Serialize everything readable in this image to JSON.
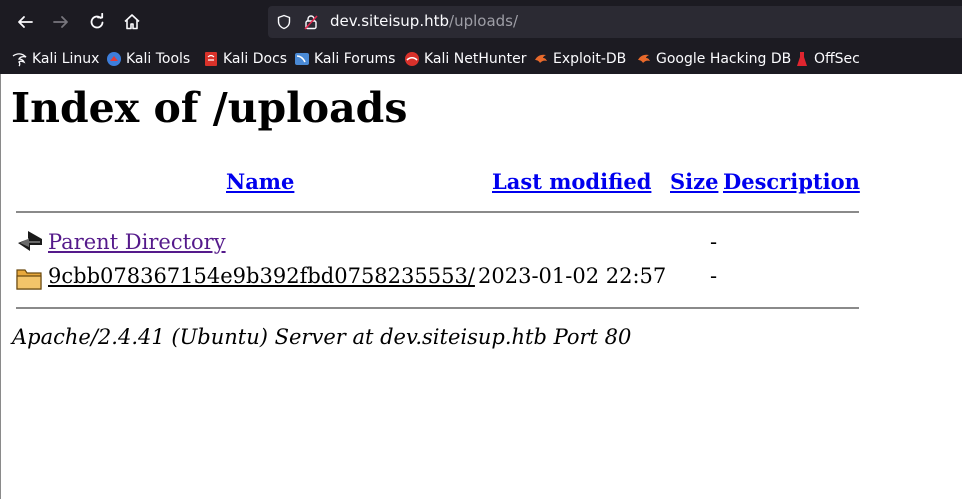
{
  "browser": {
    "url_host": "dev.siteisup.htb",
    "url_path": "/uploads/",
    "bookmarks": [
      {
        "label": "Kali Linux",
        "icon": "kali-dragon-icon"
      },
      {
        "label": "Kali Tools",
        "icon": "kali-tools-icon"
      },
      {
        "label": "Kali Docs",
        "icon": "kali-docs-icon"
      },
      {
        "label": "Kali Forums",
        "icon": "kali-forums-icon"
      },
      {
        "label": "Kali NetHunter",
        "icon": "kali-nethunter-icon"
      },
      {
        "label": "Exploit-DB",
        "icon": "exploit-db-icon"
      },
      {
        "label": "Google Hacking DB",
        "icon": "google-hacking-db-icon"
      },
      {
        "label": "OffSec",
        "icon": "offsec-icon"
      }
    ]
  },
  "page": {
    "title": "Index of /uploads",
    "columns": {
      "name": "Name",
      "last_modified": "Last modified",
      "size": "Size",
      "description": "Description"
    },
    "rows": [
      {
        "name": "Parent Directory",
        "last_modified": "",
        "size": "-",
        "icon": "back-arrow-icon"
      },
      {
        "name": "9cbb078367154e9b392fbd0758235553/",
        "last_modified": "2023-01-02 22:57",
        "size": "-",
        "icon": "folder-icon"
      }
    ],
    "footer": "Apache/2.4.41 (Ubuntu) Server at dev.siteisup.htb Port 80"
  }
}
